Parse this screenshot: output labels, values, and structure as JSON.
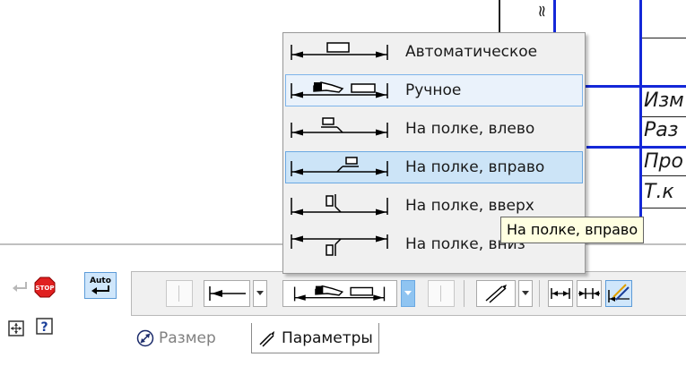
{
  "drawing": {
    "texts": [
      "Изм",
      "Раз",
      "Про",
      "Т.к"
    ],
    "top_text": "≈"
  },
  "dropdown": {
    "items": [
      {
        "label": "Автоматическое",
        "icon": "dimension-auto-icon"
      },
      {
        "label": "Ручное",
        "icon": "dimension-manual-icon"
      },
      {
        "label": "На полке, влево",
        "icon": "dimension-shelf-left-icon"
      },
      {
        "label": "На полке, вправо",
        "icon": "dimension-shelf-right-icon"
      },
      {
        "label": "На полке, вверх",
        "icon": "dimension-shelf-up-icon"
      },
      {
        "label": "На полке, вниз",
        "icon": "dimension-shelf-down-icon"
      }
    ],
    "selected_index": 1,
    "hover_index": 3
  },
  "tooltip": {
    "text": "На полке, вправо"
  },
  "sidebar": {
    "stop_label": "STOP",
    "auto_label": "Auto",
    "help_label": "?"
  },
  "toolbar": {
    "current_text_placement": "dimension-manual-icon"
  },
  "tabs": [
    {
      "label": "Размер",
      "icon": "dimension-tab-icon",
      "active": false
    },
    {
      "label": "Параметры",
      "icon": "parameters-tab-icon",
      "active": true
    }
  ],
  "colors": {
    "accent": "#1428d8",
    "selection_border": "#7eb4ea",
    "hover_fill": "#cce4f7",
    "tooltip_bg": "#ffffe1"
  }
}
